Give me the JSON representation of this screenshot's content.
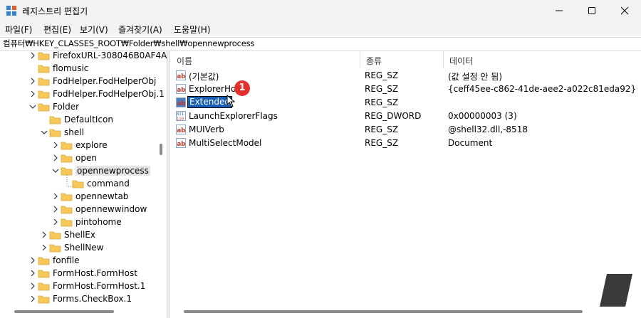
{
  "window": {
    "title": "레지스트리 편집기"
  },
  "menu": [
    "파일(F)",
    "편집(E)",
    "보기(V)",
    "즐겨찾기(A)",
    "도움말(H)"
  ],
  "address": "컴퓨터₩HKEY_CLASSES_ROOT₩Folder₩shell₩opennewprocess",
  "tree": [
    {
      "label": "FirefoxURL-308046B0AF4A",
      "chev": "right",
      "indent": 0
    },
    {
      "label": "flomusic",
      "chev": "",
      "indent": 0
    },
    {
      "label": "FodHelper.FodHelperObj",
      "chev": "right",
      "indent": 0
    },
    {
      "label": "FodHelper.FodHelperObj.1",
      "chev": "right",
      "indent": 0
    },
    {
      "label": "Folder",
      "chev": "down",
      "indent": 0
    },
    {
      "label": "DefaultIcon",
      "chev": "",
      "indent": 1
    },
    {
      "label": "shell",
      "chev": "down",
      "indent": 1
    },
    {
      "label": "explore",
      "chev": "right",
      "indent": 2
    },
    {
      "label": "open",
      "chev": "right",
      "indent": 2
    },
    {
      "label": "opennewprocess",
      "chev": "down",
      "indent": 2,
      "selected": true
    },
    {
      "label": "command",
      "chev": "",
      "indent": 3
    },
    {
      "label": "opennewtab",
      "chev": "right",
      "indent": 2
    },
    {
      "label": "opennewwindow",
      "chev": "right",
      "indent": 2
    },
    {
      "label": "pintohome",
      "chev": "right",
      "indent": 2
    },
    {
      "label": "ShellEx",
      "chev": "right",
      "indent": 1
    },
    {
      "label": "ShellNew",
      "chev": "right",
      "indent": 1
    },
    {
      "label": "fonfile",
      "chev": "right",
      "indent": 0
    },
    {
      "label": "FormHost.FormHost",
      "chev": "right",
      "indent": 0
    },
    {
      "label": "FormHost.FormHost.1",
      "chev": "right",
      "indent": 0
    },
    {
      "label": "Forms.CheckBox.1",
      "chev": "right",
      "indent": 0
    }
  ],
  "columns": {
    "name": "이름",
    "type": "종류",
    "data": "데이터"
  },
  "values": [
    {
      "name": "(기본값)",
      "type": "REG_SZ",
      "data": "(값 설정 안 됨)",
      "icon": "ab"
    },
    {
      "name": "ExplorerHost",
      "type": "REG_SZ",
      "data": "{ceff45ee-c862-41de-aee2-a022c81eda92}",
      "icon": "ab"
    },
    {
      "name": "Extended",
      "type": "REG_SZ",
      "data": "",
      "icon": "ab",
      "editing": true
    },
    {
      "name": "LaunchExplorerFlags",
      "type": "REG_DWORD",
      "data": "0x00000003 (3)",
      "icon": "bin"
    },
    {
      "name": "MUIVerb",
      "type": "REG_SZ",
      "data": "@shell32.dll,-8518",
      "icon": "ab"
    },
    {
      "name": "MultiSelectModel",
      "type": "REG_SZ",
      "data": "Document",
      "icon": "ab"
    }
  ],
  "badge": "1",
  "colors": {
    "accent": "#1a5fb4",
    "badge": "#e2312c",
    "folder": "#f6c85a"
  }
}
